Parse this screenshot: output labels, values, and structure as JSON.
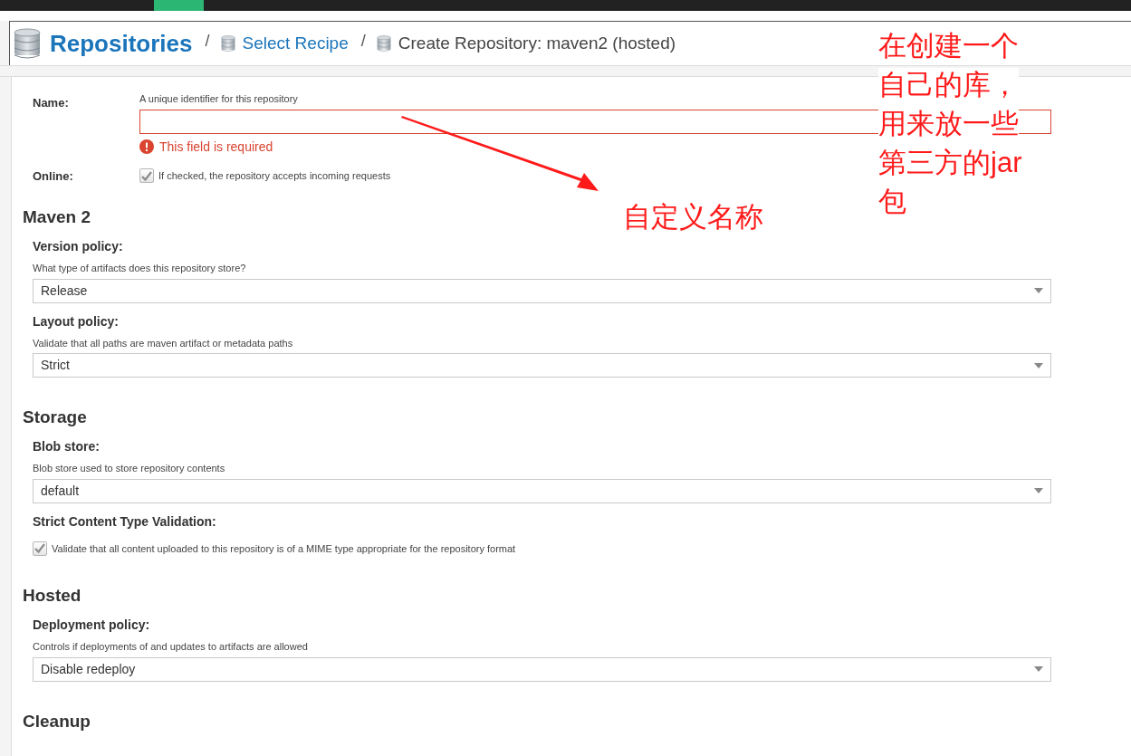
{
  "header": {
    "title": "Repositories",
    "breadcrumbs": [
      {
        "label": "Select Recipe",
        "link": true
      },
      {
        "label": "Create Repository: maven2 (hosted)",
        "link": false
      }
    ],
    "separator": "/"
  },
  "name_field": {
    "label": "Name:",
    "hint": "A unique identifier for this repository",
    "error": "This field is required"
  },
  "online": {
    "label": "Online:",
    "checked": true,
    "description": "If checked, the repository accepts incoming requests"
  },
  "sections": [
    {
      "title": "Maven 2",
      "fields": [
        {
          "kind": "select",
          "label": "Version policy:",
          "hint": "What type of artifacts does this repository store?",
          "value": "Release"
        },
        {
          "kind": "select",
          "label": "Layout policy:",
          "hint": "Validate that all paths are maven artifact or metadata paths",
          "value": "Strict"
        }
      ]
    },
    {
      "title": "Storage",
      "fields": [
        {
          "kind": "select",
          "label": "Blob store:",
          "hint": "Blob store used to store repository contents",
          "value": "default"
        },
        {
          "kind": "checkbox",
          "label": "Strict Content Type Validation:",
          "checked": true,
          "description": "Validate that all content uploaded to this repository is of a MIME type appropriate for the repository format"
        }
      ]
    },
    {
      "title": "Hosted",
      "fields": [
        {
          "kind": "select",
          "label": "Deployment policy:",
          "hint": "Controls if deployments of and updates to artifacts are allowed",
          "value": "Disable redeploy"
        }
      ]
    },
    {
      "title": "Cleanup"
    }
  ],
  "annotations": [
    {
      "kind": "arrow-label",
      "text": "自定义名称"
    },
    {
      "kind": "note",
      "lines": [
        "在创建一个",
        "自己的库，",
        "用来放一些",
        "第三方的jar",
        "包"
      ]
    }
  ]
}
